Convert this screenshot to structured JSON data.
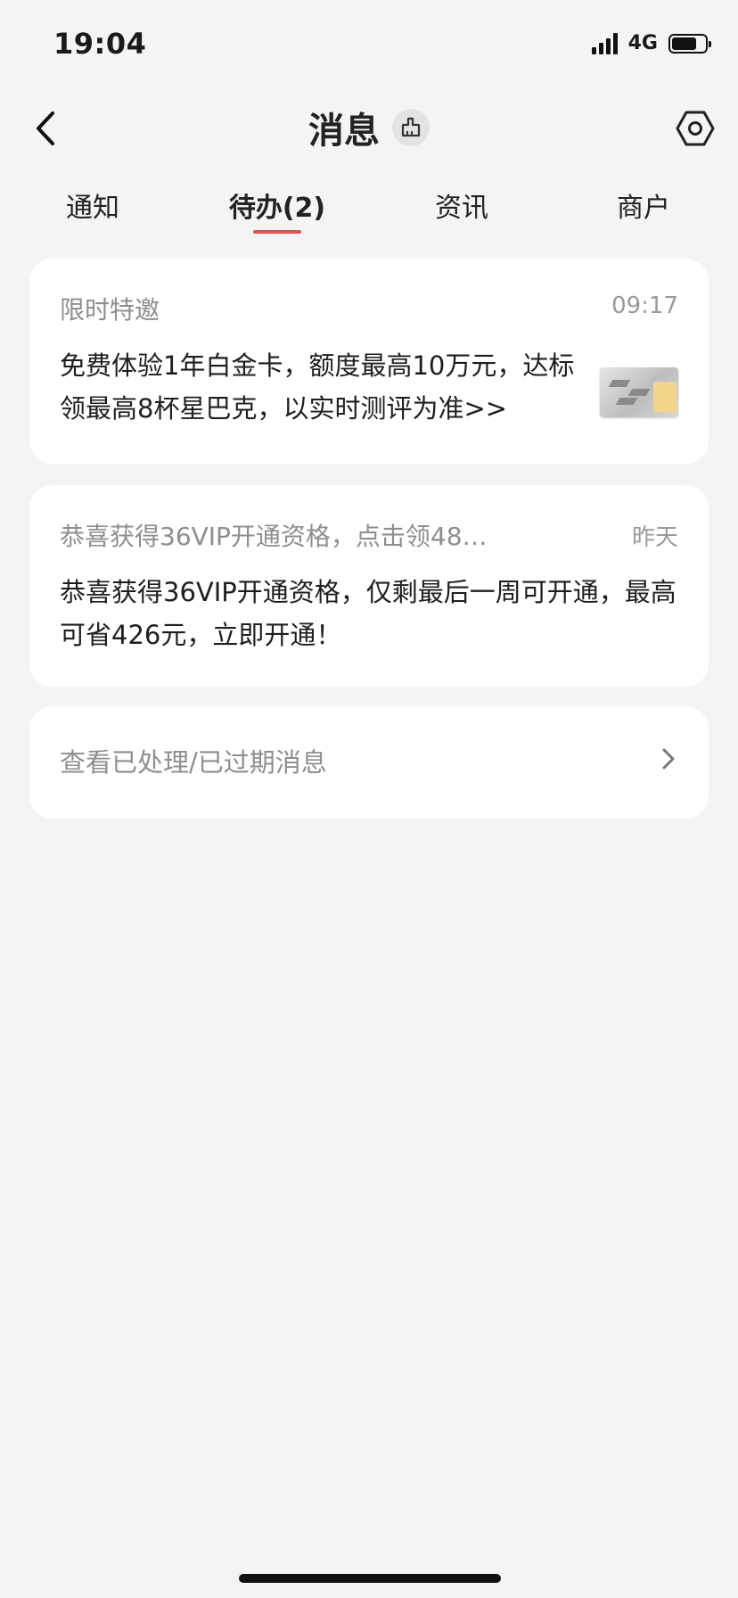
{
  "status_bar": {
    "time": "19:04",
    "network": "4G",
    "battery_level": 0.75,
    "signal_bars": 4
  },
  "header": {
    "title": "消息",
    "back_icon": "chevron-left-icon",
    "clean_icon": "broom-icon",
    "settings_icon": "hexagon-gear-icon"
  },
  "tabs": [
    {
      "label": "通知",
      "active": false
    },
    {
      "label": "待办(2)",
      "active": true
    },
    {
      "label": "资讯",
      "active": false
    },
    {
      "label": "商户",
      "active": false
    }
  ],
  "messages": [
    {
      "subject": "限时特邀",
      "time": "09:17",
      "body": "免费体验1年白金卡，额度最高10万元，达标领最高8杯星巴克，以实时测评为准>>",
      "thumbnail_icon": "credit-card-thumbnail"
    },
    {
      "subject": "恭喜获得36VIP开通资格，点击领48…",
      "time": "昨天",
      "body": "恭喜获得36VIP开通资格，仅剩最后一周可开通，最高可省426元，立即开通！"
    }
  ],
  "history_link": {
    "label": "查看已处理/已过期消息",
    "icon": "chevron-right-icon"
  },
  "colors": {
    "accent": "#e45050",
    "background": "#f4f4f4",
    "card": "#ffffff",
    "muted_text": "#8e8e8e"
  }
}
